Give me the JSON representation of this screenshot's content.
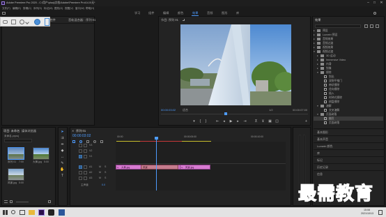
{
  "app": {
    "title": "Adobe Premiere Pro 2020 - C:\\用户\\plsaj\\文档\\Adobe\\Premiere Pro\\14.0\\无*",
    "window_controls": [
      "–",
      "□",
      "✕"
    ]
  },
  "menu": [
    "文件(F)",
    "编辑(E)",
    "剪辑(C)",
    "序列(S)",
    "标记(M)",
    "图形(G)",
    "视图(V)",
    "窗口(W)",
    "帮助(H)"
  ],
  "workspaces": {
    "items": [
      "学习",
      "组件",
      "编辑",
      "颜色",
      "效果",
      "音频",
      "图形",
      "库"
    ],
    "active": "效果"
  },
  "source_panel": {
    "tabs": [
      "效果控件",
      "音轨混合器：序列 01"
    ]
  },
  "program_monitor": {
    "title": "节目: 序列 01",
    "timecode_left": "00:00:03:02",
    "fit": "适合",
    "resolution": "1/2",
    "timecode_right": "00:00:07:00"
  },
  "project_panel": {
    "tabs": [
      "项目: 未命名",
      "媒体浏览器"
    ],
    "filename": "未命名.prproj",
    "items": [
      {
        "name": "序列 01",
        "meta": "7:00"
      },
      {
        "name": "大黄.jpg",
        "meta": "5:00"
      },
      {
        "name": "风景.jpg",
        "meta": "5:00"
      }
    ]
  },
  "timeline": {
    "tab": "序列 01",
    "timecode": "00:00:03:02",
    "ruler": [
      "00:00",
      "00:00:05:00",
      "00:00:10:00"
    ],
    "tracks": [
      {
        "name": "V3"
      },
      {
        "name": "V2"
      },
      {
        "name": "V1",
        "selected": true
      },
      {
        "name": "A1"
      },
      {
        "name": "A2"
      },
      {
        "name": "A3"
      }
    ],
    "master": "主声道",
    "master_value": "0.0",
    "clips": [
      {
        "label": "大黄.jpg",
        "color": "#d77bd1"
      },
      {
        "label": "风景",
        "color": "#d77bd1",
        "transition": true
      },
      {
        "label": "风景.jpg",
        "color": "#d77bd1"
      }
    ]
  },
  "effects_panel": {
    "title": "效果",
    "tree": [
      {
        "label": "预设",
        "depth": 0,
        "kind": "folder"
      },
      {
        "label": "Lumetri 预设",
        "depth": 0,
        "kind": "folder"
      },
      {
        "label": "音频效果",
        "depth": 0,
        "kind": "folder"
      },
      {
        "label": "音频过渡",
        "depth": 0,
        "kind": "folder"
      },
      {
        "label": "视频效果",
        "depth": 0,
        "kind": "folder"
      },
      {
        "label": "视频过渡",
        "depth": 0,
        "kind": "folder",
        "open": true
      },
      {
        "label": "3D 运动",
        "depth": 1,
        "kind": "folder"
      },
      {
        "label": "Immersive Video",
        "depth": 1,
        "kind": "folder"
      },
      {
        "label": "内滑",
        "depth": 1,
        "kind": "folder"
      },
      {
        "label": "划像",
        "depth": 1,
        "kind": "folder"
      },
      {
        "label": "擦除",
        "depth": 1,
        "kind": "folder",
        "open": true
      },
      {
        "label": "划出",
        "depth": 2,
        "kind": "effect"
      },
      {
        "label": "双侧平推门",
        "depth": 2,
        "kind": "effect"
      },
      {
        "label": "带状擦除",
        "depth": 2,
        "kind": "effect"
      },
      {
        "label": "径向擦除",
        "depth": 2,
        "kind": "effect"
      },
      {
        "label": "插入",
        "depth": 2,
        "kind": "effect"
      },
      {
        "label": "时钟式擦除",
        "depth": 2,
        "kind": "effect"
      },
      {
        "label": "棋盘擦除",
        "depth": 2,
        "kind": "effect"
      },
      {
        "label": "溶解",
        "depth": 1,
        "kind": "folder"
      },
      {
        "label": "交叉溶解",
        "depth": 2,
        "kind": "effect"
      },
      {
        "label": "页面剥落",
        "depth": 1,
        "kind": "folder",
        "open": true
      },
      {
        "label": "翻页",
        "depth": 2,
        "kind": "effect",
        "selected": true
      },
      {
        "label": "页面剥落",
        "depth": 2,
        "kind": "effect"
      }
    ],
    "bottom_panels": [
      "基本图形",
      "基本声音",
      "Lumetri 颜色",
      "库",
      "标记",
      "历史记录",
      "信息"
    ]
  },
  "taskbar": {
    "time": "15:08",
    "date": "2021/10/13"
  },
  "watermark": "最需教育"
}
